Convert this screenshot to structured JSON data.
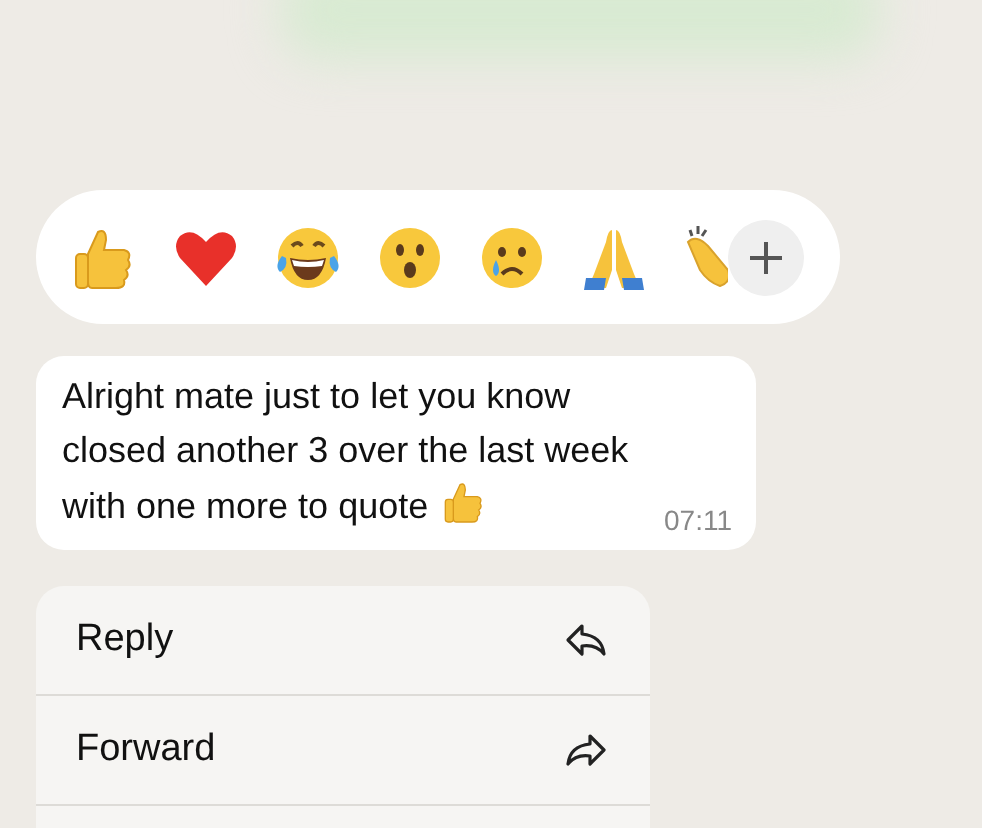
{
  "message": {
    "text": "Alright mate just to let you know closed another 3 over the last week with one more to quote",
    "time": "07:11"
  },
  "menu": [
    {
      "label": "Reply",
      "kind": "reply"
    },
    {
      "label": "Forward",
      "kind": "forward"
    }
  ]
}
